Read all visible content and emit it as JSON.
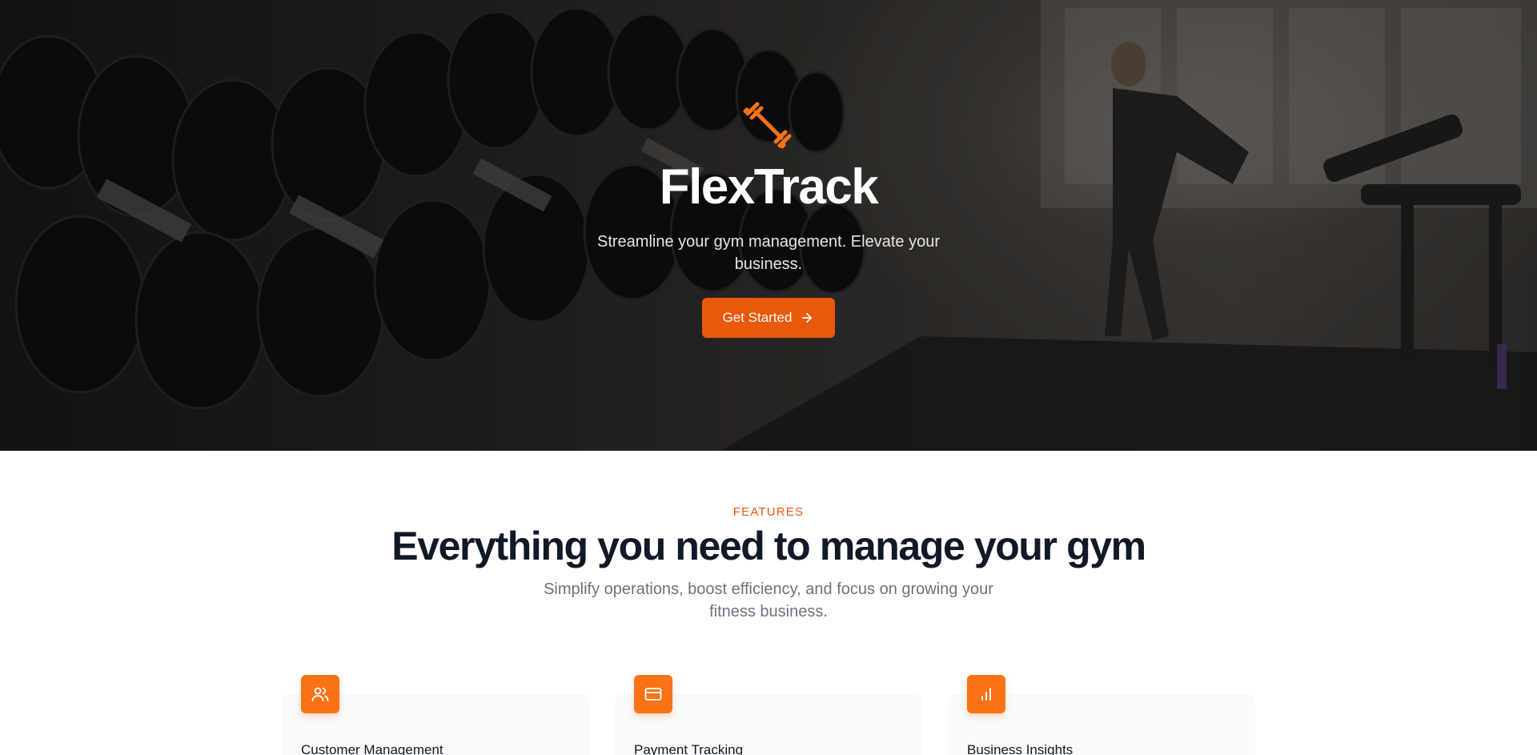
{
  "hero": {
    "brand": "FlexTrack",
    "tagline": "Streamline your gym management. Elevate your business.",
    "cta_label": "Get Started",
    "logo_icon": "dumbbell-icon",
    "cta_icon": "arrow-right-icon"
  },
  "features": {
    "eyebrow": "FEATURES",
    "title": "Everything you need to manage your gym",
    "subtitle": "Simplify operations, boost efficiency, and focus on growing your fitness business.",
    "cards": [
      {
        "title": "Customer Management",
        "icon": "users-icon"
      },
      {
        "title": "Payment Tracking",
        "icon": "credit-card-icon"
      },
      {
        "title": "Business Insights",
        "icon": "bar-chart-icon"
      }
    ]
  },
  "colors": {
    "accent": "#ea580c",
    "icon_bg": "#f97316",
    "heading": "#111827",
    "muted": "#6b7280",
    "card_bg": "#f9fafb"
  }
}
